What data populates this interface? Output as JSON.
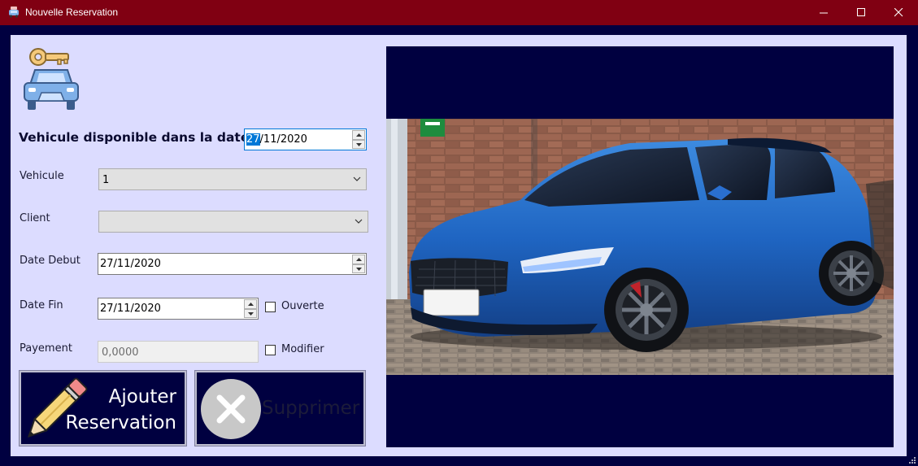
{
  "window": {
    "title": "Nouvelle Reservation",
    "icons": {
      "app": "car-app-icon",
      "minimize": "minimize-icon",
      "maximize": "maximize-icon",
      "close": "close-icon"
    }
  },
  "colors": {
    "titlebar": "#800012",
    "frame": "#000040",
    "panel": "#dcdcff",
    "accent": "#0078d7"
  },
  "form": {
    "header_label": "Vehicule disponible dans la date :",
    "date_dispo": {
      "highlighted": "27",
      "rest": "/11/2020"
    },
    "vehicule": {
      "label": "Vehicule",
      "value": "1"
    },
    "client": {
      "label": "Client",
      "value": ""
    },
    "date_debut": {
      "label": "Date Debut",
      "value": "27/11/2020"
    },
    "date_fin": {
      "label": "Date Fin",
      "value": "27/11/2020"
    },
    "ouverte": {
      "label": "Ouverte",
      "checked": false
    },
    "payement": {
      "label": "Payement",
      "value": "0,0000"
    },
    "modifier": {
      "label": "Modifier",
      "checked": false
    }
  },
  "buttons": {
    "ajouter": {
      "line1": "Ajouter",
      "line2": "Reservation",
      "icon": "pencil-icon"
    },
    "supprimer": {
      "label": "Supprimer",
      "icon": "delete-x-icon"
    }
  },
  "photo": {
    "icon": "car-photo"
  }
}
